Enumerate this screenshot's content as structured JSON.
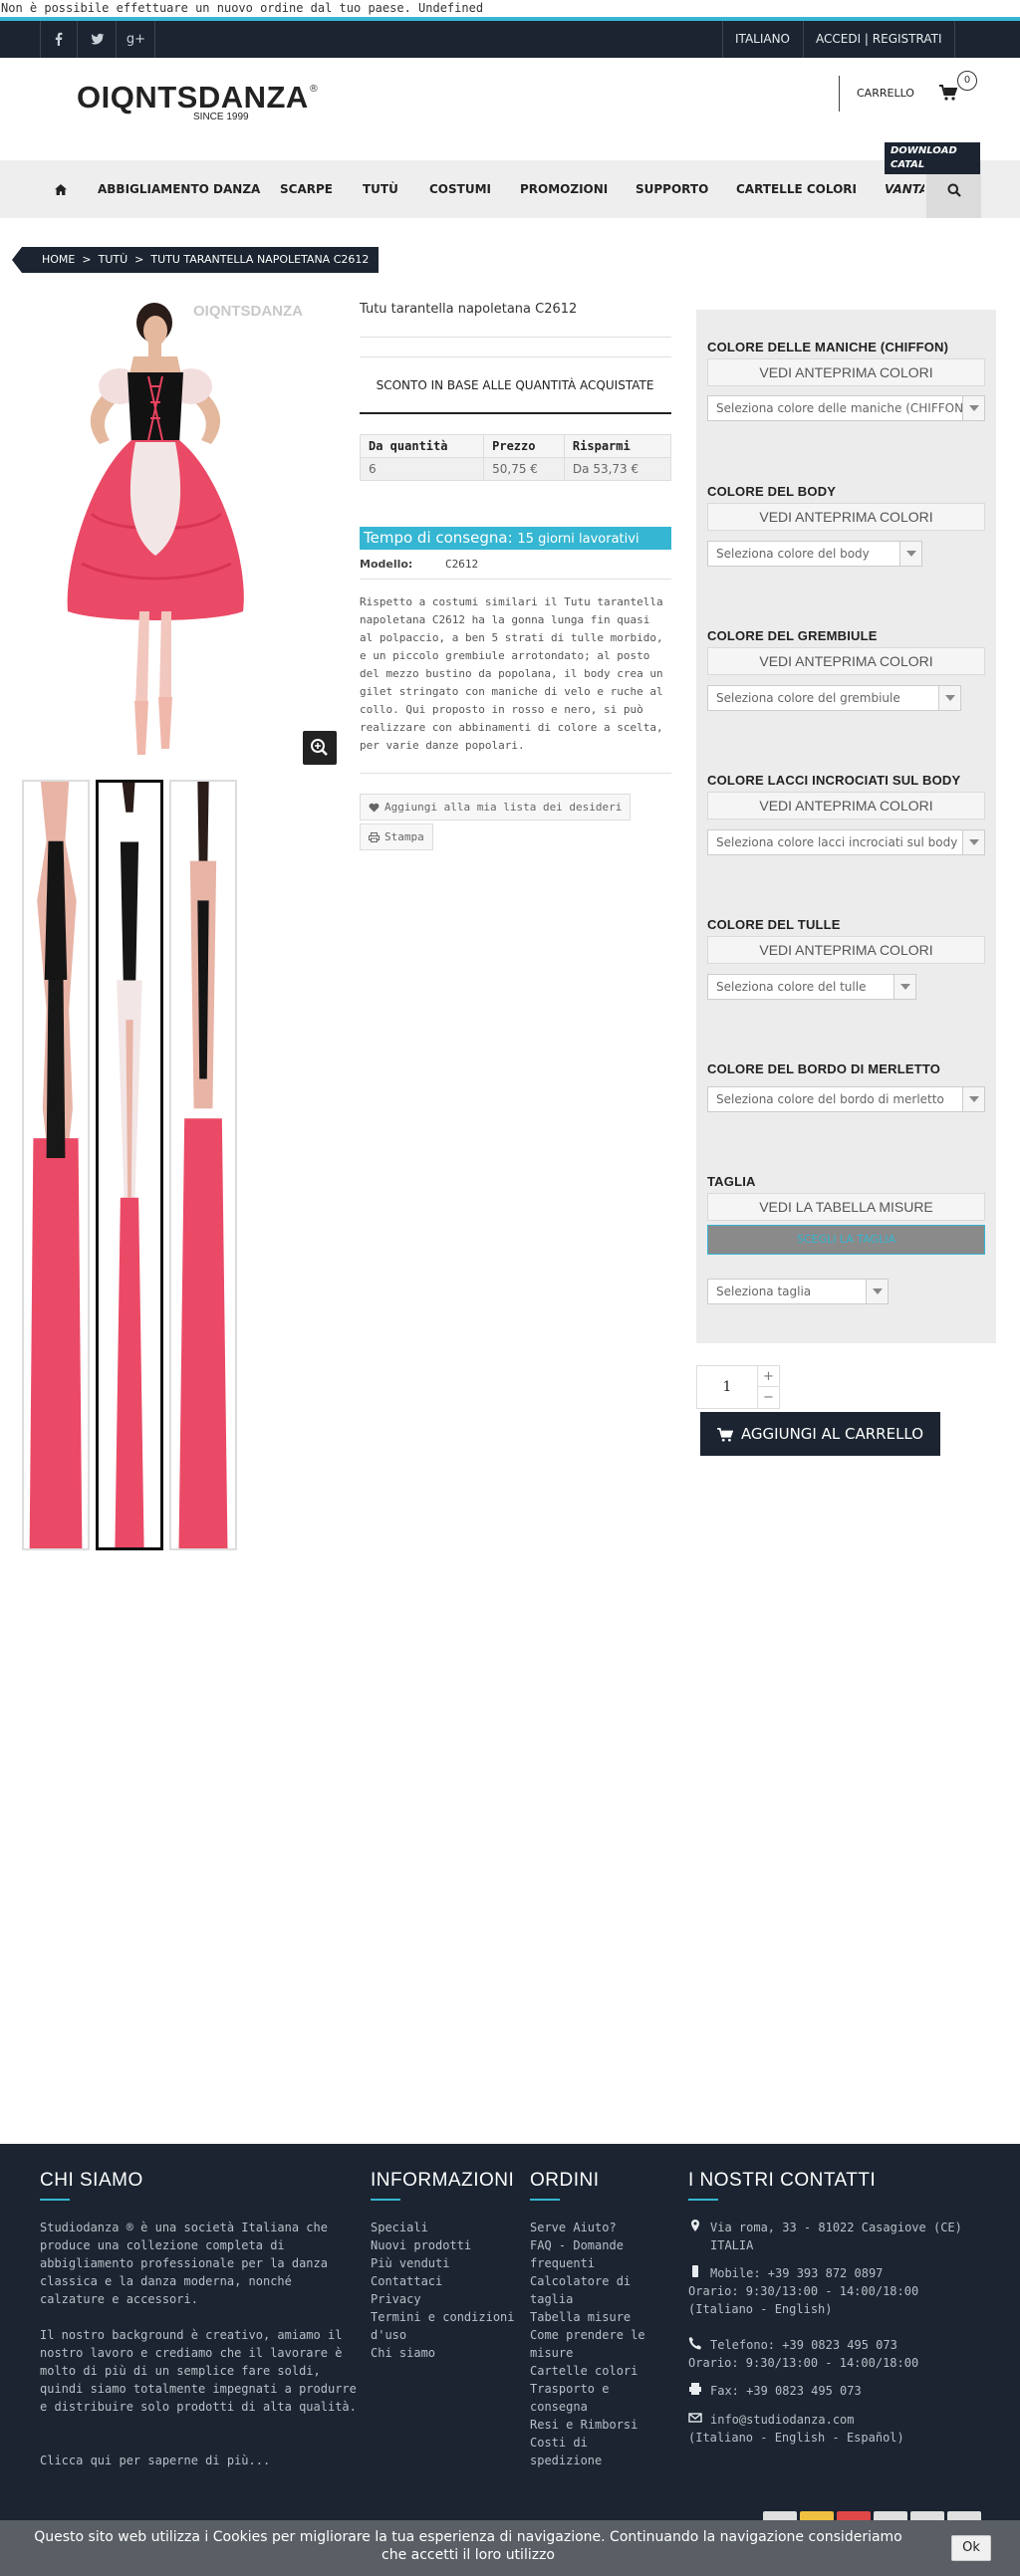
{
  "notice": "Non è possibile effettuare un nuovo ordine dal tuo paese. Undefined",
  "topbar": {
    "social": [
      "facebook-icon",
      "twitter-icon",
      "google-plus-icon"
    ],
    "language": "ITALIANO",
    "account": "ACCEDI | REGISTRATI"
  },
  "header": {
    "logo_text": "OIQNTSDANZA",
    "logo_reg": "®",
    "logo_since": "SINCE 1999",
    "cart_label": "CARRELLO",
    "cart_count": "0"
  },
  "nav": {
    "home_icon": "home-icon",
    "items": [
      "ABBIGLIAMENTO DANZA",
      "SCARPE",
      "TUTÙ",
      "COSTUMI",
      "PROMOZIONI",
      "SUPPORTO",
      "CARTELLE COLORI",
      "VANTA"
    ],
    "download_badge": [
      "DOWNLOAD",
      "CATAL"
    ],
    "search_icon": "search-icon"
  },
  "breadcrumb": [
    "HOME",
    ">",
    "TUTÙ",
    ">",
    "TUTU TARANTELLA NAPOLETANA C2612"
  ],
  "product": {
    "image_watermark": "OIQNTSDANZA",
    "title": "Tutu tarantella napoletana C2612",
    "discount_title": "SCONTO IN BASE ALLE QUANTITÀ ACQUISTATE",
    "table": {
      "headers": [
        "Da quantità",
        "Prezzo",
        "Risparmi"
      ],
      "rows": [
        [
          "6",
          "50,75 €",
          "Da 53,73 €"
        ]
      ]
    },
    "delivery_label": "Tempo di consegna:",
    "delivery_value": "15 giorni lavorativi",
    "model_label": "Modello:",
    "model_value": "C2612",
    "description": "Rispetto a costumi similari il Tutu tarantella napoletana C2612 ha la gonna lunga fin quasi al polpaccio, a ben 5 strati di tulle morbido, e un piccolo grembiule arrotondato; al posto del mezzo bustino da popolana, il body crea un gilet stringato con maniche di velo e ruche al collo. Qui proposto in rosso e nero, si può realizzare con abbinamenti di colore a scelta, per varie danze popolari.",
    "wishlist_label": "Aggiungi alla mia lista dei desideri",
    "print_label": "Stampa"
  },
  "options": {
    "preview_label": "VEDI ANTEPRIMA COLORI",
    "groups": [
      {
        "title": "COLORE DELLE MANICHE (CHIFFON)",
        "select": "Seleziona colore delle maniche (CHIFFON)"
      },
      {
        "title": "COLORE DEL BODY",
        "select": "Seleziona colore del body"
      },
      {
        "title": "COLORE DEL GREMBIULE",
        "select": "Seleziona colore del grembiule"
      },
      {
        "title": "COLORE LACCI INCROCIATI SUL BODY",
        "select": "Seleziona colore lacci incrociati sul body"
      },
      {
        "title": "COLORE DEL TULLE",
        "select": "Seleziona colore del tulle"
      },
      {
        "title": "COLORE DEL BORDO DI MERLETTO",
        "select": "Seleziona colore del bordo di merletto"
      }
    ],
    "size_title": "TAGLIA",
    "size_table_label": "VEDI LA TABELLA MISURE",
    "size_choose_label": "SCEGLI LA TAGLIA",
    "size_select": "Seleziona taglia"
  },
  "cart": {
    "quantity": "1",
    "plus": "+",
    "minus": "−",
    "add_label": "AGGIUNGI AL CARRELLO"
  },
  "footer": {
    "about_title": "CHI SIAMO",
    "about_p1": "Studiodanza ® è una società Italiana che produce una collezione completa di abbigliamento professionale per la danza classica e la danza moderna, nonché calzature e accessori.",
    "about_p2": "Il nostro background è creativo, amiamo il nostro lavoro e crediamo che il lavorare è molto di più di un semplice fare soldi, quindi siamo totalmente impegnati a produrre e distribuire solo prodotti di alta qualità.",
    "about_more": "Clicca qui per saperne di più...",
    "info_title": "INFORMAZIONI",
    "info_links": [
      "Speciali",
      "Nuovi prodotti",
      "Più venduti",
      "Contattaci",
      "Privacy",
      "Termini e condizioni d'uso",
      "Chi siamo"
    ],
    "orders_title": "ORDINI",
    "orders_links": [
      "Serve Aiuto?",
      "FAQ - Domande frequenti",
      "Calcolatore di taglia",
      "Tabella misure",
      "Come prendere le misure",
      "Cartelle colori",
      "Trasporto e consegna",
      "Resi e Rimborsi",
      "Costi di spedizione"
    ],
    "contact_title": "I NOSTRI CONTATTI",
    "address": "Via roma, 33 - 81022 Casagiove (CE) ITALIA",
    "mobile": "Mobile: +39 393 872 0897",
    "mobile_hours": "Orario: 9:30/13:00 - 14:00/18:00",
    "mobile_lang": "(Italiano - English)",
    "phone": "Telefono: +39 0823 495 073",
    "phone_hours": "Orario: 9:30/13:00 - 14:00/18:00",
    "fax": "Fax: +39 0823 495 073",
    "email": "info@studiodanza.com",
    "email_lang": "(Italiano - English - Español)"
  },
  "cookie": {
    "text": "Questo sito web utilizza i Cookies per migliorare la tua esperienza di navigazione. Continuando la navigazione consideriamo che accetti il loro utilizzo",
    "ok": "Ok"
  }
}
